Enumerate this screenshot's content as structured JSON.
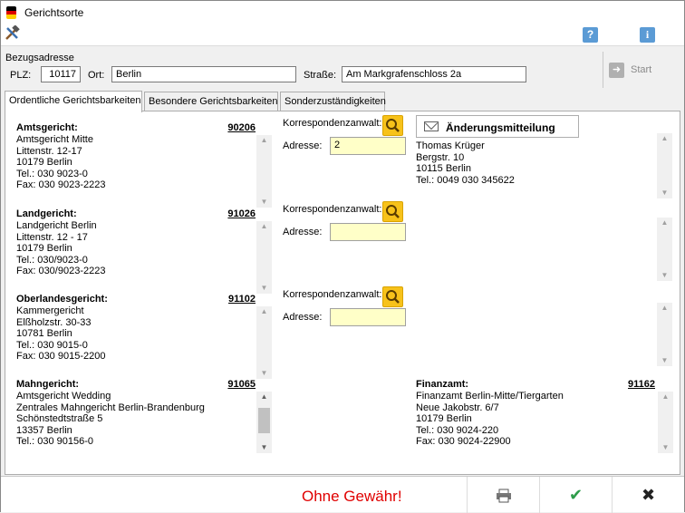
{
  "window": {
    "title": "Gerichtsorte"
  },
  "toolbar": {
    "tools_icon": "hammer-wrench-icon",
    "help_icon": "?",
    "info_icon": "i"
  },
  "address": {
    "group_label": "Bezugsadresse",
    "plz_label": "PLZ:",
    "plz_value": "10117",
    "ort_label": "Ort:",
    "ort_value": "Berlin",
    "strasse_label": "Straße:",
    "strasse_value": "Am Markgrafenschloss 2a",
    "start_label": "Start"
  },
  "tabs": [
    {
      "label": "Ordentliche Gerichtsbarkeiten",
      "active": true
    },
    {
      "label": "Besondere Gerichtsbarkeiten",
      "active": false
    },
    {
      "label": "Sonderzuständigkeiten",
      "active": false
    }
  ],
  "courts": {
    "amtsgericht": {
      "name": "Amtsgericht:",
      "code": "90206",
      "lines": [
        "Amtsgericht Mitte",
        "Littenstr. 12-17",
        "10179 Berlin",
        "Tel.: 030 9023-0",
        "Fax: 030 9023-2223"
      ]
    },
    "landgericht": {
      "name": "Landgericht:",
      "code": "91026",
      "lines": [
        "Landgericht Berlin",
        "Littenstr. 12 - 17",
        "10179 Berlin",
        "Tel.: 030/9023-0",
        "Fax: 030/9023-2223"
      ]
    },
    "oberlandesgericht": {
      "name": "Oberlandesgericht:",
      "code": "91102",
      "lines": [
        "Kammergericht",
        "Elßholzstr. 30-33",
        "10781 Berlin",
        "Tel.: 030 9015-0",
        "Fax: 030 9015-2200"
      ]
    },
    "mahngericht": {
      "name": "Mahngericht:",
      "code": "91065",
      "lines": [
        "Amtsgericht Wedding",
        "Zentrales Mahngericht Berlin-Brandenburg",
        "Schönstedtstraße 5",
        "13357 Berlin",
        "Tel.: 030 90156-0"
      ]
    },
    "finanzamt": {
      "name": "Finanzamt:",
      "code": "91162",
      "lines": [
        "Finanzamt Berlin-Mitte/Tiergarten",
        "Neue Jakobstr. 6/7",
        "10179 Berlin",
        "Tel.: 030 9024-220",
        "Fax: 030 9024-22900"
      ]
    }
  },
  "korrespondenz": {
    "label": "Korrespondenzanwalt:",
    "address_label": "Adresse:",
    "amtsgericht_address": "2",
    "landgericht_address": "",
    "oberlandesgericht_address": ""
  },
  "change_notice": {
    "button_label": "Änderungsmitteilung",
    "lines": [
      "Thomas Krüger",
      "Bergstr. 10",
      "10115 Berlin",
      "Tel.: 0049 030 345622"
    ]
  },
  "statusbar": {
    "warning": "Ohne Gewähr!",
    "print_icon": "printer-icon",
    "ok_icon": "✔",
    "cancel_icon": "✖"
  },
  "colors": {
    "warning": "#e00000",
    "accent_yellow": "#f7c21a",
    "field_yellow": "#ffffc8",
    "ok_green": "#2e9c4a"
  }
}
